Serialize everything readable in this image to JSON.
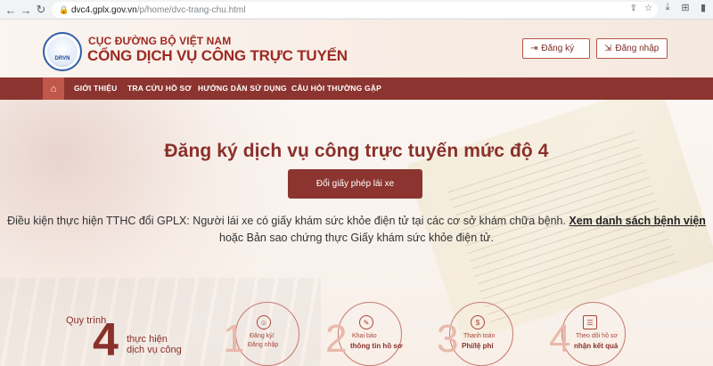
{
  "browser": {
    "url_host": "dvc4.gplx.gov.vn",
    "url_path": "/p/home/dvc-trang-chu.html"
  },
  "header": {
    "logo_text": "DRVN",
    "org_name": "CỤC ĐƯỜNG BỘ VIỆT NAM",
    "site_name": "CỔNG DỊCH VỤ CÔNG TRỰC TUYẾN",
    "register_label": "Đăng ký",
    "login_label": "Đăng nhập"
  },
  "menu": {
    "items": [
      {
        "label": "GIỚI THIỆU"
      },
      {
        "label": "TRA CỨU HỒ SƠ"
      },
      {
        "label": "HƯỚNG DẪN SỬ DỤNG"
      },
      {
        "label": "CÂU HỎI THƯỜNG GẶP"
      }
    ]
  },
  "hero": {
    "title": "Đăng ký dịch vụ công trực tuyến mức độ 4",
    "button_label": "Đổi giấy phép lái xe",
    "desc_before": "Điều kiện thực hiện TTHC đổi GPLX: Người lái xe có giấy khám sức khỏe điện tử tại các cơ sở khám chữa bệnh. ",
    "desc_link": "Xem danh sách bệnh viện",
    "desc_after": " hoặc Bản sao chứng thực Giấy khám sức khỏe điện tử."
  },
  "process": {
    "label_top": "Quy trình",
    "big_number": "4",
    "label_line1": "thực hiện",
    "label_line2": "dịch vụ công",
    "steps": [
      {
        "num": "1",
        "line1": "Đăng ký/",
        "line2": "Đăng nhập"
      },
      {
        "num": "2",
        "line1": "Khai báo",
        "line2": "thông tin hồ sơ"
      },
      {
        "num": "3",
        "line1": "Thanh toán",
        "line2": "Phí/lệ phí"
      },
      {
        "num": "4",
        "line1": "Theo dõi hồ sơ",
        "line2": "nhận kết quả"
      }
    ]
  },
  "colors": {
    "brand": "#8c3530",
    "title": "#8a302a",
    "menu_active": "#c0574b"
  }
}
